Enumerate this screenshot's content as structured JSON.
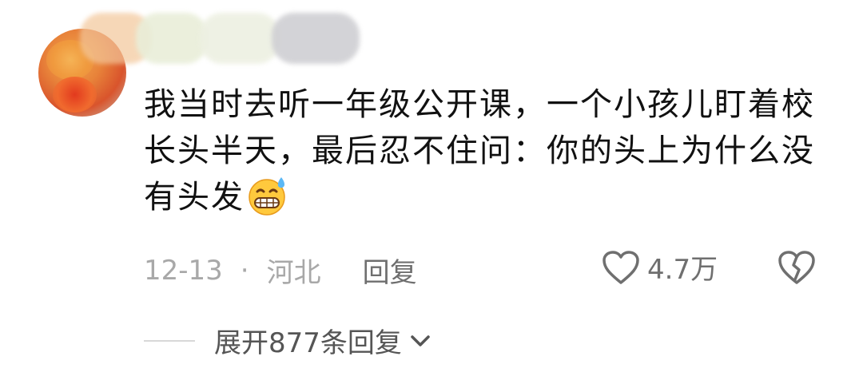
{
  "comment": {
    "text": "我当时去听一年级公开课，一个小孩儿盯着校长头半天，最后忍不住问：你的头上为什么没有头发",
    "emoji": "sweat-grin-emoji"
  },
  "meta": {
    "date": "12-13",
    "separator": "·",
    "location": "河北",
    "reply_label": "回复"
  },
  "actions": {
    "like_count": "4.7万",
    "like_icon": "heart-outline-icon",
    "dislike_icon": "broken-heart-icon"
  },
  "replies": {
    "expand_label": "展开877条回复",
    "expand_icon": "chevron-down-icon"
  }
}
